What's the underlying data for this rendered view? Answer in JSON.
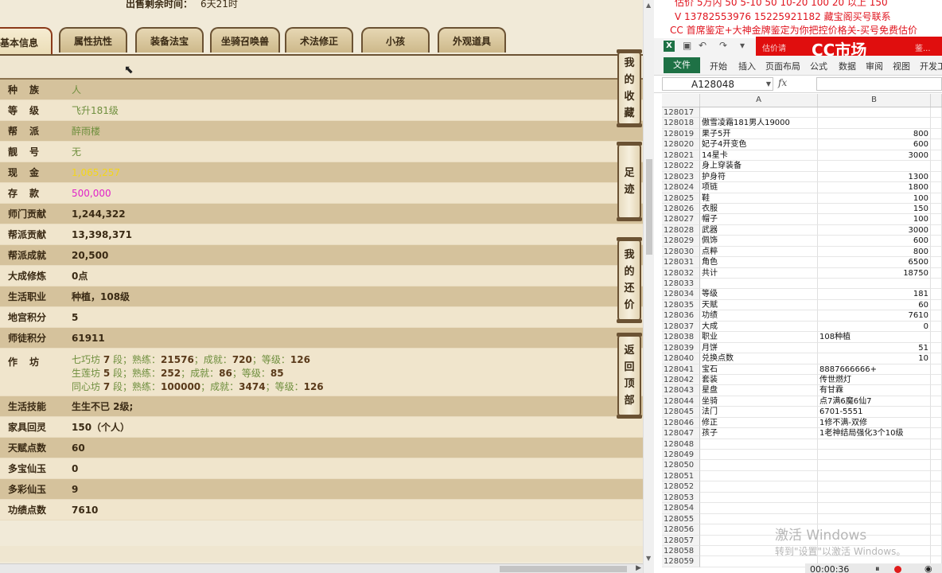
{
  "left_panel": {
    "sale_info": {
      "label": "出售剩余时间：",
      "value": "6天21时"
    },
    "tabs": [
      "基本信息",
      "属性抗性",
      "装备法宝",
      "坐骑召唤兽",
      "术法修正",
      "小孩",
      "外观道具"
    ],
    "active_tab": 0,
    "rows": [
      {
        "label": "种族",
        "value": "人",
        "style": "green",
        "spaced": true
      },
      {
        "label": "等级",
        "value": "飞升181级",
        "style": "green",
        "spaced": true
      },
      {
        "label": "帮派",
        "value": "醉雨楼",
        "style": "green",
        "spaced": true
      },
      {
        "label": "靓号",
        "value": "无",
        "style": "green",
        "spaced": true
      },
      {
        "label": "现金",
        "value": "1,065,257",
        "style": "yellow",
        "spaced": true
      },
      {
        "label": "存款",
        "value": "500,000",
        "style": "magenta",
        "spaced": true
      },
      {
        "label": "师门贡献",
        "value": "1,244,322",
        "style": "dark"
      },
      {
        "label": "帮派贡献",
        "value": "13,398,371",
        "style": "dark"
      },
      {
        "label": "帮派成就",
        "value": "20,500",
        "style": "dark"
      },
      {
        "label": "大成修炼",
        "value": "0点",
        "style": "dark"
      },
      {
        "label": "生活职业",
        "value": "种植，108级",
        "style": "dark"
      },
      {
        "label": "地宫积分",
        "value": "5",
        "style": "dark"
      },
      {
        "label": "师徒积分",
        "value": "61911",
        "style": "dark"
      }
    ],
    "workshop": {
      "label": "作坊",
      "lines": [
        {
          "name": "七巧坊",
          "stage": "7",
          "skill": "21576",
          "achieve": "720",
          "level": "126"
        },
        {
          "name": "生莲坊",
          "stage": "5",
          "skill": "252",
          "achieve": "86",
          "level": "85"
        },
        {
          "name": "同心坊",
          "stage": "7",
          "skill": "100000",
          "achieve": "3474",
          "level": "126"
        }
      ],
      "stage_suffix": "段；熟练：",
      "achieve_prefix": "；成就：",
      "level_prefix": "；等级："
    },
    "rows2": [
      {
        "label": "生活技能",
        "value": "生生不已 2级;",
        "style": "dark"
      },
      {
        "label": "家具回灵",
        "value": "150（个人）",
        "style": "dark"
      },
      {
        "label": "天赋点数",
        "value": "60",
        "style": "dark"
      },
      {
        "label": "多宝仙玉",
        "value": "0",
        "style": "dark"
      },
      {
        "label": "多彩仙玉",
        "value": "9",
        "style": "dark"
      },
      {
        "label": "功绩点数",
        "value": "7610",
        "style": "dark"
      }
    ],
    "side_buttons": [
      {
        "name": "my-favorites-button",
        "chars": [
          "我",
          "的",
          "收",
          "藏"
        ]
      },
      {
        "name": "footprint-button",
        "chars": [
          "足",
          "迹"
        ]
      },
      {
        "name": "my-offer-button",
        "chars": [
          "我",
          "的",
          "还",
          "价"
        ]
      },
      {
        "name": "back-to-top-button",
        "chars": [
          "返",
          "回",
          "顶",
          "部"
        ]
      }
    ]
  },
  "right_panel": {
    "promo_lines": [
      "估价 5万内 50  5-10 50  10-20 100  20 以上 150",
      "V 13782553976    15225921182   藏宝阁买号联系",
      "CC 首席鉴定+大神金牌鉴定为你把控价格关-买号免费估价"
    ],
    "banner": {
      "left": "估价请",
      "logo": "CC市场",
      "right": "鉴..."
    },
    "ribbon_tabs": [
      "开始",
      "插入",
      "页面布局",
      "公式",
      "数据",
      "审阅",
      "视图",
      "开发工"
    ],
    "file_tab": "文件",
    "name_box": "A128048",
    "fx": "fx",
    "columns": [
      "A",
      "B"
    ],
    "rows": [
      [
        "128017",
        "",
        ""
      ],
      [
        "128018",
        "傲雪凌霜181男人19000",
        ""
      ],
      [
        "128019",
        "果子5开",
        "800"
      ],
      [
        "128020",
        "妃子4开变色",
        "600"
      ],
      [
        "128021",
        "14星卡",
        "3000"
      ],
      [
        "128022",
        "身上穿装备",
        ""
      ],
      [
        "128023",
        "护身符",
        "1300"
      ],
      [
        "128024",
        "项链",
        "1800"
      ],
      [
        "128025",
        "鞋",
        "100"
      ],
      [
        "128026",
        "衣服",
        "150"
      ],
      [
        "128027",
        "帽子",
        "100"
      ],
      [
        "128028",
        "武器",
        "3000"
      ],
      [
        "128029",
        "佩饰",
        "600"
      ],
      [
        "128030",
        "点粹",
        "800"
      ],
      [
        "128031",
        "角色",
        "6500"
      ],
      [
        "128032",
        "共计",
        "18750"
      ],
      [
        "128033",
        "",
        ""
      ],
      [
        "128034",
        "等级",
        "181"
      ],
      [
        "128035",
        "天赋",
        "60"
      ],
      [
        "128036",
        "功绩",
        "7610"
      ],
      [
        "128037",
        "大成",
        "0"
      ],
      [
        "128038",
        "职业",
        "108种植"
      ],
      [
        "128039",
        "月饼",
        "51"
      ],
      [
        "128040",
        "兑换点数",
        "10"
      ],
      [
        "128041",
        "宝石",
        "8887666666+"
      ],
      [
        "128042",
        "套装",
        "传世燃灯"
      ],
      [
        "128043",
        "星盘",
        "有甘霖"
      ],
      [
        "128044",
        "坐骑",
        "点7满6魔6仙7"
      ],
      [
        "128045",
        "法门",
        "6701-5551"
      ],
      [
        "128046",
        "修正",
        "1修不满-双修"
      ],
      [
        "128047",
        "孩子",
        "1老神结局强化3个10级"
      ],
      [
        "128048",
        "",
        ""
      ],
      [
        "128049",
        "",
        ""
      ],
      [
        "128050",
        "",
        ""
      ],
      [
        "128051",
        "",
        ""
      ],
      [
        "128052",
        "",
        ""
      ],
      [
        "128053",
        "",
        ""
      ],
      [
        "128054",
        "",
        ""
      ],
      [
        "128055",
        "",
        ""
      ],
      [
        "128056",
        "",
        ""
      ],
      [
        "128057",
        "",
        ""
      ],
      [
        "128058",
        "",
        ""
      ],
      [
        "128059",
        "",
        ""
      ]
    ],
    "text_b_rows": [
      "128038",
      "128041",
      "128042",
      "128043",
      "128044",
      "128045",
      "128046",
      "128047"
    ],
    "watermark": "激活 Windows",
    "watermark_sub": "转到\"设置\"以激活 Windows。",
    "recorder": {
      "time": "00:00:36"
    }
  }
}
